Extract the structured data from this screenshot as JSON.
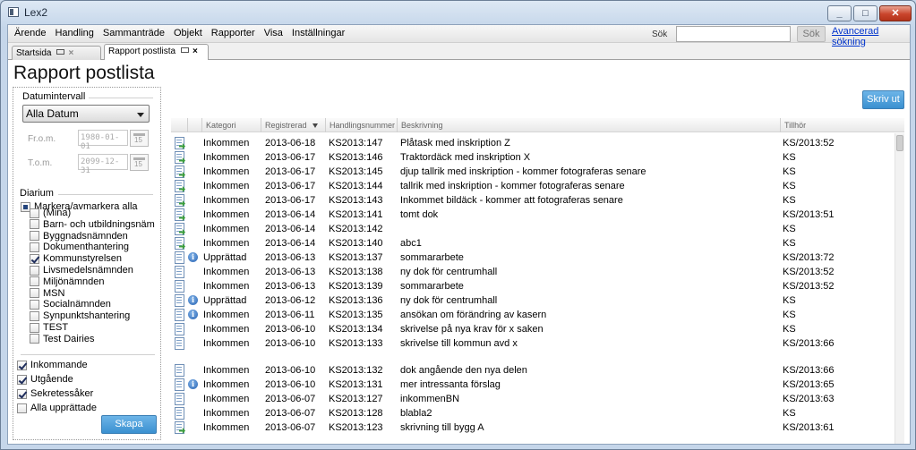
{
  "window": {
    "title": "Lex2",
    "minimize": "_",
    "maximize": "□",
    "close": "✕"
  },
  "menubar": {
    "items": [
      "Ärende",
      "Handling",
      "Sammanträde",
      "Objekt",
      "Rapporter",
      "Visa",
      "Inställningar"
    ],
    "search_label": "Sök",
    "search_value": "",
    "search_button": "Sök",
    "advanced_search": "Avancerad sökning"
  },
  "tabs": [
    {
      "label": "Startsida",
      "active": false
    },
    {
      "label": "Rapport postlista",
      "active": true
    }
  ],
  "page_title": "Rapport postlista",
  "filters": {
    "date_interval_title": "Datumintervall",
    "date_select": "Alla Datum",
    "from_label": "Fr.o.m.",
    "from_value": "1980-01-01",
    "to_label": "T.o.m.",
    "to_value": "2099-12-31",
    "calendar_glyph": "15",
    "diarium_title": "Diarium",
    "select_all_label": "Markera/avmarkera alla",
    "diarier": [
      {
        "label": "(Mina)",
        "checked": false
      },
      {
        "label": "Barn- och utbildningsnämnd",
        "checked": false
      },
      {
        "label": "Byggnadsnämnden",
        "checked": false
      },
      {
        "label": "Dokumenthantering",
        "checked": false
      },
      {
        "label": "Kommunstyrelsen",
        "checked": true
      },
      {
        "label": "Livsmedelsnämnden",
        "checked": false
      },
      {
        "label": "Miljönämnden",
        "checked": false
      },
      {
        "label": "MSN",
        "checked": false
      },
      {
        "label": "Socialnämnden",
        "checked": false
      },
      {
        "label": "Synpunktshantering",
        "checked": false
      },
      {
        "label": "TEST",
        "checked": false
      },
      {
        "label": "Test Dairies",
        "checked": false
      }
    ],
    "types": [
      {
        "label": "Inkommande",
        "checked": true
      },
      {
        "label": "Utgående",
        "checked": true
      },
      {
        "label": "Sekretessåker",
        "checked": true
      },
      {
        "label": "Alla upprättade",
        "checked": false
      }
    ],
    "create_button": "Skapa"
  },
  "print_button": "Skriv ut",
  "table": {
    "columns": [
      "Kategori",
      "Registrerad",
      "Handlingsnummer",
      "Beskrivning",
      "Tillhör"
    ],
    "rows": [
      {
        "icon": "doc-incoming-icon",
        "info": false,
        "kategori": "Inkommen",
        "registrerad": "2013-06-18",
        "nummer": "KS2013:147",
        "beskrivning": "Plåtask med inskription Z",
        "tillhor": "KS/2013:52"
      },
      {
        "icon": "doc-incoming-icon",
        "info": false,
        "kategori": "Inkommen",
        "registrerad": "2013-06-17",
        "nummer": "KS2013:146",
        "beskrivning": "Traktordäck med inskription X",
        "tillhor": "KS"
      },
      {
        "icon": "doc-incoming-icon",
        "info": false,
        "kategori": "Inkommen",
        "registrerad": "2013-06-17",
        "nummer": "KS2013:145",
        "beskrivning": "djup tallrik med inskription - kommer fotograferas senare",
        "tillhor": "KS"
      },
      {
        "icon": "doc-incoming-icon",
        "info": false,
        "kategori": "Inkommen",
        "registrerad": "2013-06-17",
        "nummer": "KS2013:144",
        "beskrivning": "tallrik med inskription - kommer fotograferas senare",
        "tillhor": "KS"
      },
      {
        "icon": "doc-incoming-icon",
        "info": false,
        "kategori": "Inkommen",
        "registrerad": "2013-06-17",
        "nummer": "KS2013:143",
        "beskrivning": "Inkommet bildäck - kommer att fotograferas senare",
        "tillhor": "KS"
      },
      {
        "icon": "doc-incoming-icon",
        "info": false,
        "kategori": "Inkommen",
        "registrerad": "2013-06-14",
        "nummer": "KS2013:141",
        "beskrivning": "tomt dok",
        "tillhor": "KS/2013:51"
      },
      {
        "icon": "doc-incoming-icon",
        "info": false,
        "kategori": "Inkommen",
        "registrerad": "2013-06-14",
        "nummer": "KS2013:142",
        "beskrivning": "",
        "tillhor": "KS"
      },
      {
        "icon": "doc-incoming-icon",
        "info": false,
        "kategori": "Inkommen",
        "registrerad": "2013-06-14",
        "nummer": "KS2013:140",
        "beskrivning": "abc1",
        "tillhor": "KS"
      },
      {
        "icon": "doc-icon",
        "info": true,
        "kategori": "Upprättad",
        "registrerad": "2013-06-13",
        "nummer": "KS2013:137",
        "beskrivning": "sommararbete",
        "tillhor": "KS/2013:72"
      },
      {
        "icon": "doc-icon",
        "info": false,
        "kategori": "Inkommen",
        "registrerad": "2013-06-13",
        "nummer": "KS2013:138",
        "beskrivning": "ny dok för centrumhall",
        "tillhor": "KS/2013:52"
      },
      {
        "icon": "doc-icon",
        "info": false,
        "kategori": "Inkommen",
        "registrerad": "2013-06-13",
        "nummer": "KS2013:139",
        "beskrivning": "sommararbete",
        "tillhor": "KS/2013:52"
      },
      {
        "icon": "doc-icon",
        "info": true,
        "kategori": "Upprättad",
        "registrerad": "2013-06-12",
        "nummer": "KS2013:136",
        "beskrivning": "ny dok för centrumhall",
        "tillhor": "KS"
      },
      {
        "icon": "doc-icon",
        "info": true,
        "kategori": "Inkommen",
        "registrerad": "2013-06-11",
        "nummer": "KS2013:135",
        "beskrivning": "ansökan om förändring av kasern",
        "tillhor": "KS"
      },
      {
        "icon": "doc-icon",
        "info": false,
        "kategori": "Inkommen",
        "registrerad": "2013-06-10",
        "nummer": "KS2013:134",
        "beskrivning": "skrivelse på nya krav för x saken",
        "tillhor": "KS"
      },
      {
        "icon": "doc-icon",
        "info": false,
        "kategori": "Inkommen",
        "registrerad": "2013-06-10",
        "nummer": "KS2013:133",
        "beskrivning": "skrivelse till kommun avd x",
        "tillhor": "KS/2013:66"
      },
      {
        "icon": "doc-icon",
        "info": false,
        "kategori": "Inkommen",
        "registrerad": "2013-06-10",
        "nummer": "KS2013:132",
        "beskrivning": "dok angående den nya delen",
        "tillhor": "KS/2013:66"
      },
      {
        "icon": "doc-icon",
        "info": true,
        "kategori": "Inkommen",
        "registrerad": "2013-06-10",
        "nummer": "KS2013:131",
        "beskrivning": "mer intressanta förslag",
        "tillhor": "KS/2013:65"
      },
      {
        "icon": "doc-icon",
        "info": false,
        "kategori": "Inkommen",
        "registrerad": "2013-06-07",
        "nummer": "KS2013:127",
        "beskrivning": "inkommenBN",
        "tillhor": "KS/2013:63"
      },
      {
        "icon": "doc-icon",
        "info": false,
        "kategori": "Inkommen",
        "registrerad": "2013-06-07",
        "nummer": "KS2013:128",
        "beskrivning": "blabla2",
        "tillhor": "KS"
      },
      {
        "icon": "doc-incoming-icon",
        "info": false,
        "kategori": "Inkommen",
        "registrerad": "2013-06-07",
        "nummer": "KS2013:123",
        "beskrivning": "skrivning till bygg A",
        "tillhor": "KS/2013:61"
      }
    ]
  }
}
